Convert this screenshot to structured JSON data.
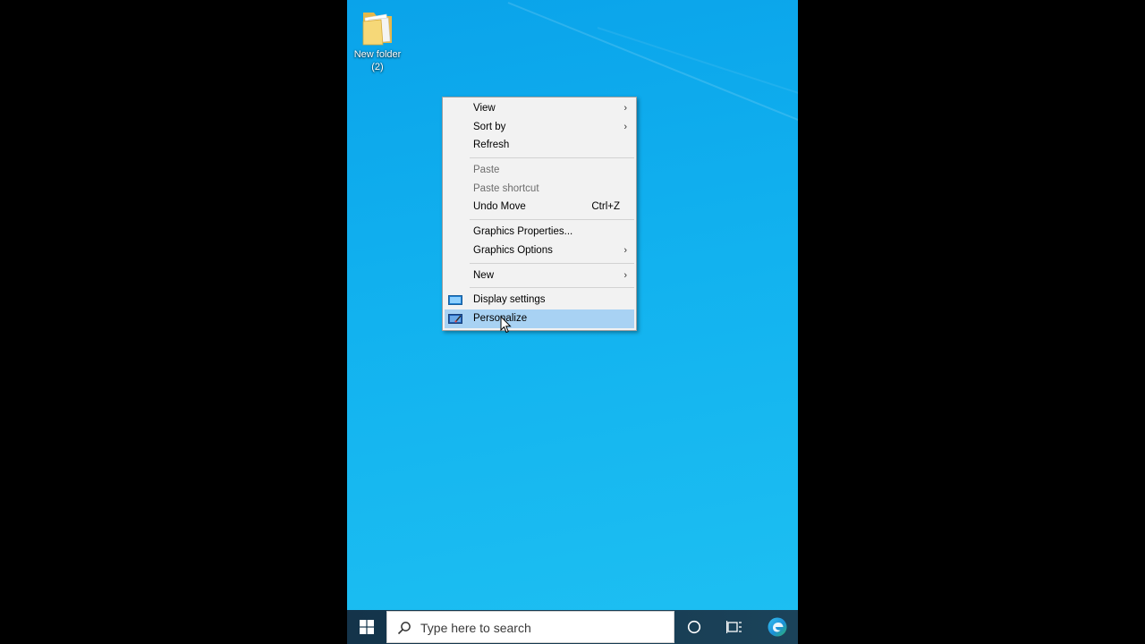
{
  "desktop": {
    "icon_label": "New folder\n(2)"
  },
  "context_menu": {
    "items": [
      {
        "label": "View",
        "submenu": true
      },
      {
        "label": "Sort by",
        "submenu": true
      },
      {
        "label": "Refresh"
      },
      {
        "label": "Paste",
        "disabled": true
      },
      {
        "label": "Paste shortcut",
        "disabled": true
      },
      {
        "label": "Undo Move",
        "shortcut": "Ctrl+Z"
      },
      {
        "label": "Graphics Properties..."
      },
      {
        "label": "Graphics Options",
        "submenu": true
      },
      {
        "label": "New",
        "submenu": true
      },
      {
        "label": "Display settings",
        "icon": "display-icon"
      },
      {
        "label": "Personalize",
        "icon": "personalize-icon",
        "highlighted": true
      }
    ],
    "arrow_glyph": "›"
  },
  "taskbar": {
    "search_placeholder": "Type here to search",
    "buttons": [
      "start-icon",
      "search-icon",
      "cortana-icon",
      "task-view-icon",
      "edge-icon"
    ]
  },
  "colors": {
    "desktop_bg": "#12b2ef",
    "menu_bg": "#f2f2f2",
    "menu_highlight": "#a8d2f3",
    "taskbar_bg": "#1b435a"
  }
}
